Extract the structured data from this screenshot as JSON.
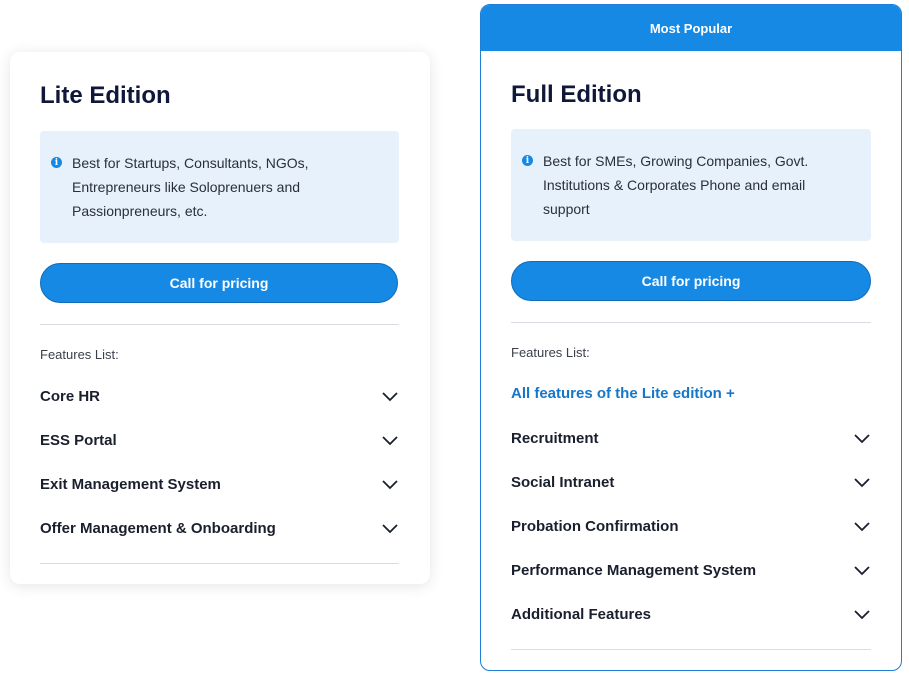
{
  "lite": {
    "title": "Lite Edition",
    "info": "Best for Startups, Consultants, NGOs, Entrepreneurs like Soloprenuers and Passionpreneurs, etc.",
    "cta_label": "Call for pricing",
    "features_label": "Features List:",
    "features": [
      "Core HR",
      "ESS Portal",
      "Exit Management System",
      "Offer Management & Onboarding"
    ]
  },
  "full": {
    "badge": "Most Popular",
    "title": "Full Edition",
    "info": "Best for SMEs, Growing Companies, Govt. Institutions & Corporates Phone and email support",
    "cta_label": "Call for pricing",
    "features_label": "Features List:",
    "all_features_link": "All features of the Lite edition +",
    "features": [
      "Recruitment",
      "Social Intranet",
      "Probation Confirmation",
      "Performance Management System",
      "Additional Features"
    ]
  },
  "icons": {
    "info": "info-icon",
    "expand": "chevron-down-icon"
  },
  "colors": {
    "accent": "#1689e4",
    "info_bg": "#e6f1fc",
    "link": "#1677c9"
  }
}
